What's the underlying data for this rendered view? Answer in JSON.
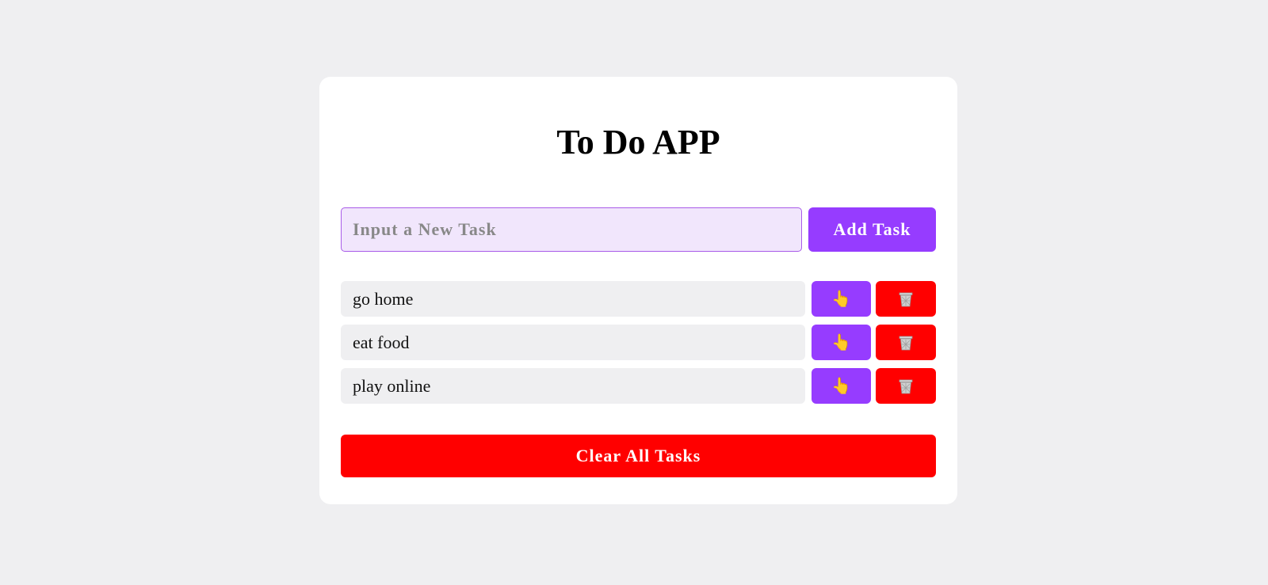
{
  "app": {
    "title": "To Do APP"
  },
  "input": {
    "placeholder": "Input a New Task",
    "value": ""
  },
  "add_button": {
    "label": "Add Task"
  },
  "tasks": [
    {
      "text": "go home",
      "done_icon": "pointing-hand-icon",
      "delete_icon": "trash-icon"
    },
    {
      "text": "eat food",
      "done_icon": "pointing-hand-icon",
      "delete_icon": "trash-icon"
    },
    {
      "text": "play online",
      "done_icon": "pointing-hand-icon",
      "delete_icon": "trash-icon"
    }
  ],
  "clear_button": {
    "label": "Clear All Tasks"
  },
  "colors": {
    "background": "#efeff1",
    "card": "#ffffff",
    "accent_purple": "#963cff",
    "danger_red": "#ff0000",
    "input_bg": "#f1e6fc"
  }
}
